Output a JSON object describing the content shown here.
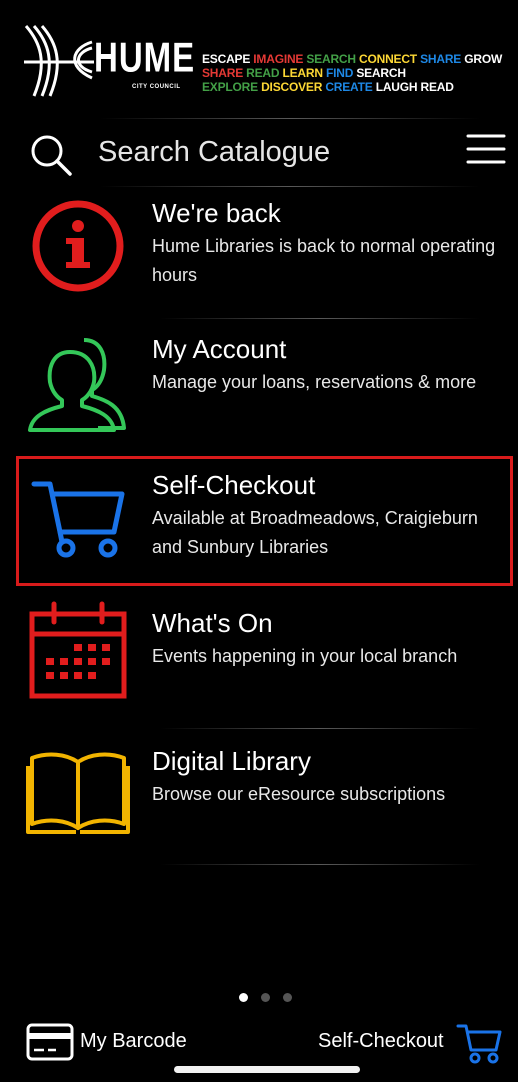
{
  "header": {
    "logo_name": "HUME",
    "logo_sub": "CITY COUNCIL",
    "banner_lines": [
      "ESCAPE IMAGINE SEARCH CONNECT SHARE GROW",
      "SHARE READ LEARN FIND SEARCH",
      "EXPLORE DISCOVER CREATE LAUGH READ"
    ],
    "banner_colors": [
      "#ffffff",
      "#e53935",
      "#43a047",
      "#fdd835",
      "#1e88e5",
      "#ffffff"
    ]
  },
  "search": {
    "placeholder": "Search Catalogue",
    "icon": "search-icon",
    "menu_icon": "hamburger-menu-icon"
  },
  "items": [
    {
      "title": "We're back",
      "description": "Hume Libraries is back to normal operating hours",
      "icon": "info-icon",
      "color": "#e11d1d"
    },
    {
      "title": "My Account",
      "description": "Manage your loans, reservations & more",
      "icon": "people-icon",
      "color": "#34c759"
    },
    {
      "title": "Self-Checkout",
      "description": "Available at Broadmeadows, Craigieburn and Sunbury Libraries",
      "icon": "cart-icon",
      "color": "#1a73e8",
      "highlight_color": "#d81b1b"
    },
    {
      "title": "What's On",
      "description": "Events happening in your local branch",
      "icon": "calendar-icon",
      "color": "#e11d1d"
    },
    {
      "title": "Digital Library",
      "description": "Browse our eResource subscriptions",
      "icon": "book-icon",
      "color": "#f2b400"
    }
  ],
  "pagination": {
    "count": 3,
    "active_index": 0
  },
  "bottom_bar": {
    "left_label": "My Barcode",
    "left_icon": "barcode-card-icon",
    "right_label": "Self-Checkout",
    "right_icon": "cart-icon",
    "right_icon_color": "#1a73e8"
  }
}
